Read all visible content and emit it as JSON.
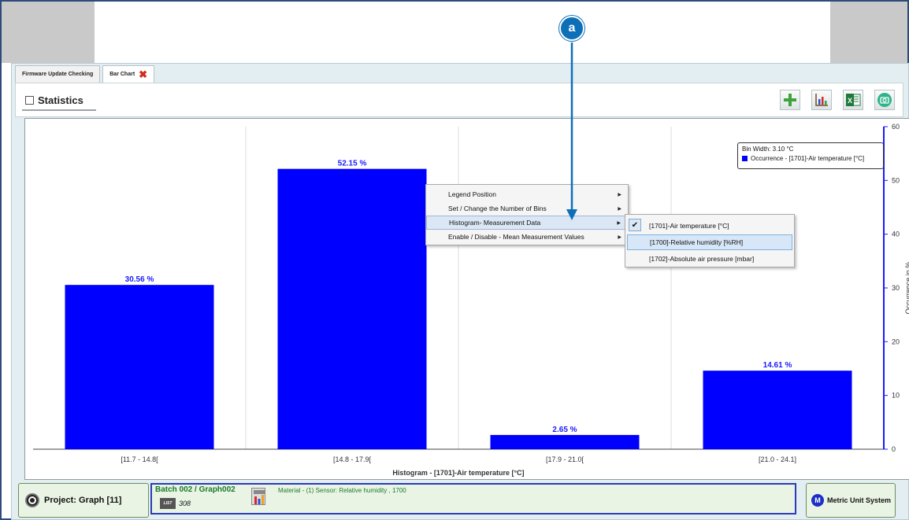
{
  "tabs": [
    {
      "label": "Firmware Update Checking",
      "active": false
    },
    {
      "label": "Bar Chart",
      "active": true
    }
  ],
  "toolbar": {
    "statistics_label": "Statistics",
    "buttons": [
      "add-icon",
      "bar-chart-icon",
      "excel-export-icon",
      "screenshot-icon"
    ]
  },
  "annotation": {
    "label": "a"
  },
  "chart_data": {
    "type": "bar",
    "categories": [
      "[11.7 - 14.8[",
      "[14.8 - 17.9[",
      "[17.9 - 21.0[",
      "[21.0 - 24.1]"
    ],
    "values": [
      30.56,
      52.15,
      2.65,
      14.61
    ],
    "value_labels": [
      "30.56 %",
      "52.15 %",
      "2.65 %",
      "14.61 %"
    ],
    "xlabel": "Histogram - [1701]-Air temperature [°C]",
    "ylabel": "Occurrence in %",
    "ylim": [
      0,
      60
    ],
    "yticks": [
      0,
      10,
      20,
      30,
      40,
      50,
      60
    ],
    "y_axis_side": "right",
    "bar_color": "#0000ff",
    "legend": {
      "position": "top-right",
      "bin_width": "Bin Width:  3.10 °C",
      "series_name": "Occurrence - [1701]-Air temperature [°C]"
    },
    "grid": true
  },
  "context_menu": {
    "items": [
      {
        "label": "Legend Position",
        "submenu": true
      },
      {
        "label": "Set /  Change the Number of Bins",
        "submenu": true
      },
      {
        "label": "Histogram- Measurement Data",
        "submenu": true
      },
      {
        "label": "Enable / Disable - Mean Measurement Values",
        "submenu": true
      }
    ],
    "submenu_items": [
      {
        "label": "[1701]-Air temperature [°C]",
        "checked": true
      },
      {
        "label": "[1700]-Relative humidity [%RH]",
        "checked": false
      },
      {
        "label": "[1702]-Absolute air pressure [mbar]",
        "checked": false
      }
    ]
  },
  "footer": {
    "project": "Project: Graph [11]",
    "batch_title": "Batch 002 / Graph002",
    "batch_list_icon": "LIST",
    "batch_count": "308",
    "material": "Material - (1) Sensor: Relative humidity ,  1700",
    "metric_icon_letter": "M",
    "metric": "Metric Unit System"
  }
}
